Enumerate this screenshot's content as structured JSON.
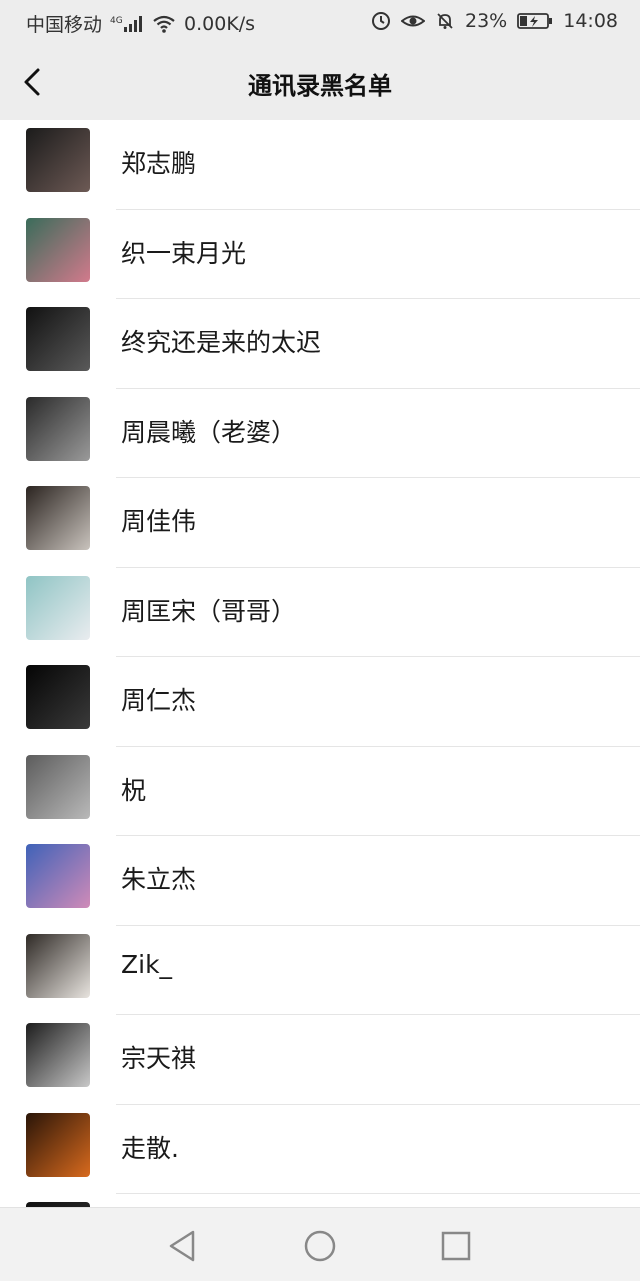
{
  "status_bar": {
    "carrier": "中国移动",
    "network": "4G",
    "speed": "0.00K/s",
    "battery": "23%",
    "time": "14:08"
  },
  "nav": {
    "title": "通讯录黑名单",
    "back_icon": "chevron-left-icon"
  },
  "contacts": [
    {
      "name": "郑志鹏",
      "avatar_colors": [
        "#1b1b1b",
        "#6d5a55"
      ]
    },
    {
      "name": "织一束月光",
      "avatar_colors": [
        "#3a6c5a",
        "#d27a8c"
      ]
    },
    {
      "name": "终究还是来的太迟",
      "avatar_colors": [
        "#111111",
        "#5a5a5a"
      ]
    },
    {
      "name": "周晨曦（老婆）",
      "avatar_colors": [
        "#2a2a2a",
        "#9a9a9a"
      ]
    },
    {
      "name": "周佳伟",
      "avatar_colors": [
        "#2b2420",
        "#c9c3bd"
      ]
    },
    {
      "name": "周匡宋（哥哥）",
      "avatar_colors": [
        "#8fc4c4",
        "#e9ecef"
      ]
    },
    {
      "name": "周仁杰",
      "avatar_colors": [
        "#050505",
        "#3a3a3a"
      ]
    },
    {
      "name": "柷",
      "avatar_colors": [
        "#5c5c5c",
        "#b9b9b9"
      ]
    },
    {
      "name": "朱立杰",
      "avatar_colors": [
        "#3f62b8",
        "#d08bb8"
      ]
    },
    {
      "name": "Zik_",
      "avatar_colors": [
        "#2f2a26",
        "#e8e4df"
      ]
    },
    {
      "name": "宗天祺",
      "avatar_colors": [
        "#1d1d1d",
        "#c8c8c8"
      ]
    },
    {
      "name": "走散.",
      "avatar_colors": [
        "#2a1508",
        "#d86a1e"
      ]
    },
    {
      "name": "",
      "avatar_colors": [
        "#111111",
        "#333333"
      ]
    }
  ],
  "bottom_nav": {
    "back_icon": "triangle-back-icon",
    "home_icon": "circle-home-icon",
    "recents_icon": "square-recents-icon"
  }
}
